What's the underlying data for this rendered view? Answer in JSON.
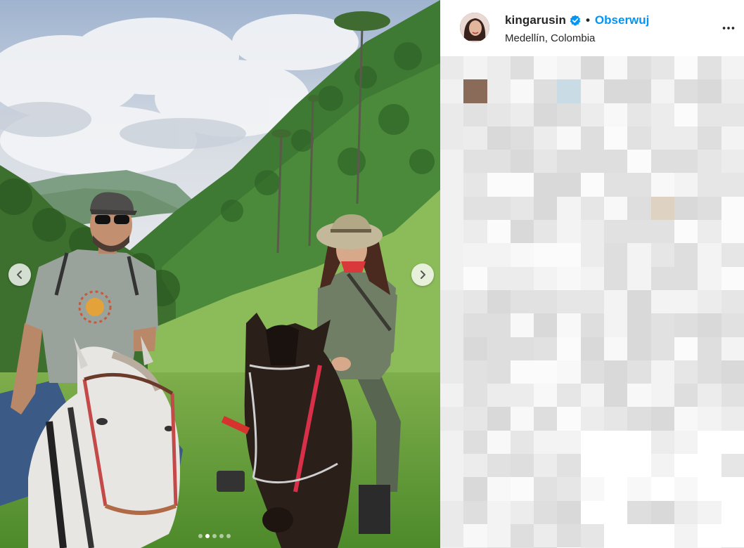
{
  "post": {
    "username": "kingarusin",
    "follow_label": "Obserwuj",
    "separator": "•",
    "location": "Medellín, Colombia",
    "verified": true,
    "more_icon": "more-horizontal-icon"
  },
  "carousel": {
    "total_slides": 5,
    "active_slide": 2,
    "prev_icon": "chevron-left-icon",
    "next_icon": "chevron-right-icon"
  },
  "colors": {
    "follow_blue": "#0095f6",
    "verified_blue": "#0095f6",
    "text": "#262626"
  }
}
